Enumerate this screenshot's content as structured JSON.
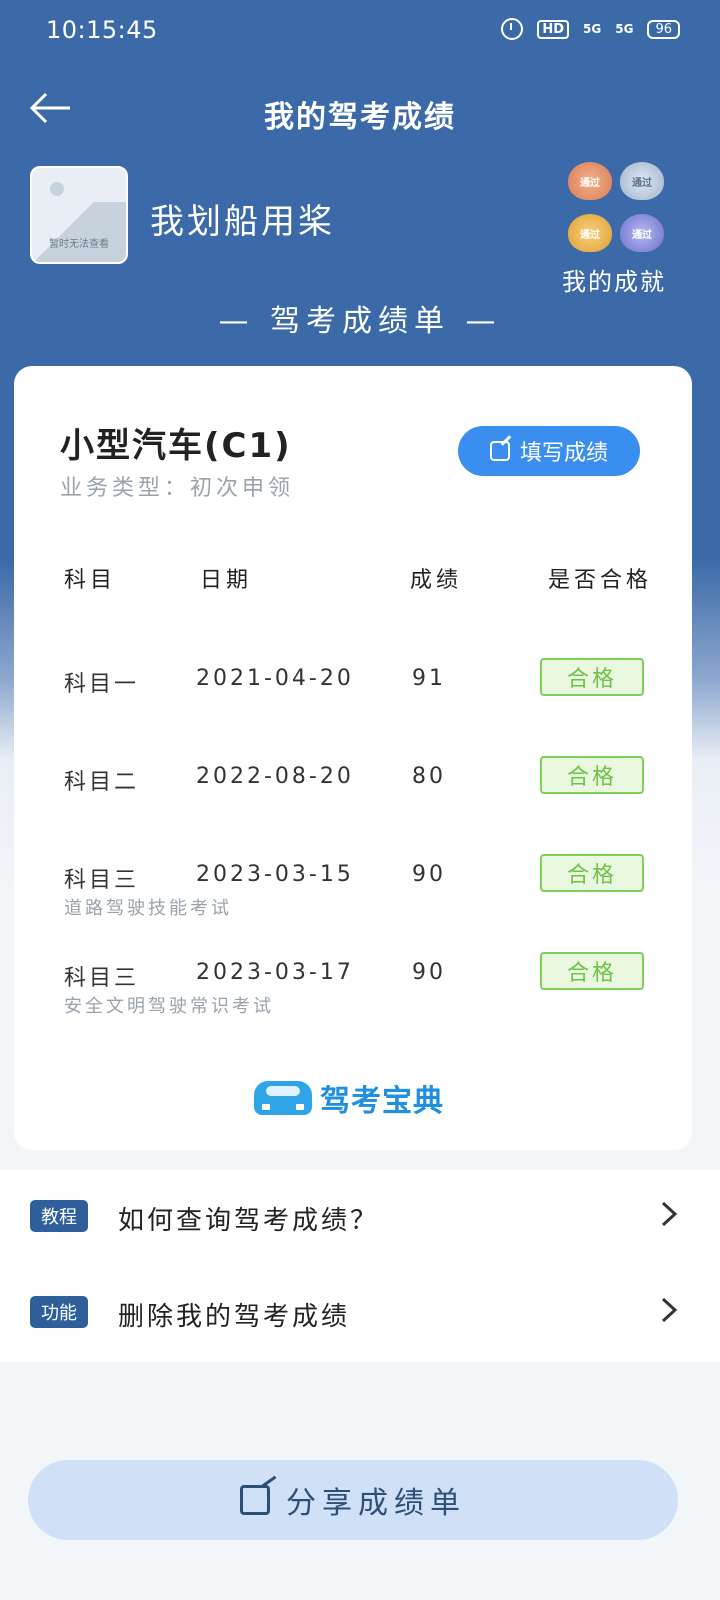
{
  "status_bar": {
    "time": "10:15:45",
    "hd_label": "HD",
    "signal_1": "5G",
    "signal_2": "5G",
    "battery": "96"
  },
  "header": {
    "title": "我的驾考成绩"
  },
  "profile": {
    "avatar_caption": "暂时无法查看",
    "username": "我划船用桨",
    "achievements_label": "我的成就",
    "badges": [
      "通过",
      "通过",
      "通过",
      "通过"
    ]
  },
  "section_title": "— 驾考成绩单 —",
  "card": {
    "license": "小型汽车(C1)",
    "business_type": "业务类型：初次申领",
    "fill_button": "填写成绩",
    "columns": [
      "科目",
      "日期",
      "成绩",
      "是否合格"
    ],
    "rows": [
      {
        "subject": "科目一",
        "date": "2021-04-20",
        "score": "91",
        "result": "合格",
        "note": ""
      },
      {
        "subject": "科目二",
        "date": "2022-08-20",
        "score": "80",
        "result": "合格",
        "note": ""
      },
      {
        "subject": "科目三",
        "date": "2023-03-15",
        "score": "90",
        "result": "合格",
        "note": "道路驾驶技能考试"
      },
      {
        "subject": "科目三",
        "date": "2023-03-17",
        "score": "90",
        "result": "合格",
        "note": "安全文明驾驶常识考试"
      }
    ],
    "logo_text": "驾考宝典"
  },
  "links": [
    {
      "tag": "教程",
      "text": "如何查询驾考成绩？"
    },
    {
      "tag": "功能",
      "text": "删除我的驾考成绩"
    }
  ],
  "share_button": "分享成绩单",
  "colors": {
    "header_blue": "#3c6aa8",
    "button_blue": "#3a8ef0",
    "pass_green": "#6fc14a",
    "share_bg": "#cfe0f7"
  }
}
